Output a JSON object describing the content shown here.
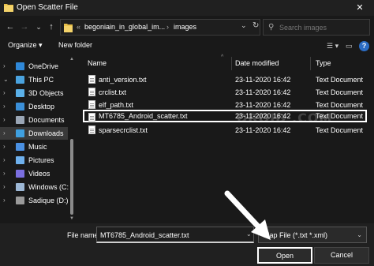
{
  "window": {
    "title": "Open Scatter File",
    "close_glyph": "✕"
  },
  "nav": {
    "back_glyph": "←",
    "forward_glyph": "→",
    "recent_glyph": "⌄",
    "up_glyph": "↑",
    "address": {
      "prefix": "«",
      "segment1": "begoniain_in_global_im...",
      "sep": "›",
      "segment2": "images",
      "dropdown_glyph": "⌄",
      "refresh_glyph": "↻"
    },
    "search_placeholder": "Search images",
    "search_glyph": "⚲"
  },
  "toolbar": {
    "organize": "Organize ▾",
    "new_folder": "New folder",
    "view_glyph": "☰ ▾",
    "pane_glyph": "▭",
    "help_glyph": "?"
  },
  "sidebar": {
    "items": [
      {
        "label": "OneDrive",
        "chevron": "›",
        "icon": "cloud-icon",
        "color": "#2f88d8"
      },
      {
        "label": "This PC",
        "chevron": "⌄",
        "icon": "computer-icon",
        "color": "#4aa3df"
      },
      {
        "label": "3D Objects",
        "chevron": "›",
        "icon": "3d-objects-icon",
        "color": "#5bb0e8"
      },
      {
        "label": "Desktop",
        "chevron": "›",
        "icon": "desktop-icon",
        "color": "#3b8fd8"
      },
      {
        "label": "Documents",
        "chevron": "›",
        "icon": "documents-icon",
        "color": "#9aa6b5"
      },
      {
        "label": "Downloads",
        "chevron": "›",
        "icon": "downloads-icon",
        "color": "#3fa0e0"
      },
      {
        "label": "Music",
        "chevron": "›",
        "icon": "music-icon",
        "color": "#4a90e2"
      },
      {
        "label": "Pictures",
        "chevron": "›",
        "icon": "pictures-icon",
        "color": "#6fb1ee"
      },
      {
        "label": "Videos",
        "chevron": "›",
        "icon": "videos-icon",
        "color": "#7b6fe0"
      },
      {
        "label": "Windows (C:",
        "chevron": "›",
        "icon": "drive-icon",
        "color": "#9db8d6"
      },
      {
        "label": "Sadique (D:)",
        "chevron": "›",
        "icon": "drive-icon",
        "color": "#9a9a9a"
      }
    ],
    "selected_index": 5
  },
  "columns": {
    "name": "Name",
    "date": "Date modified",
    "type": "Type",
    "sort_glyph": "^"
  },
  "files": [
    {
      "name": "anti_version.txt",
      "date": "23-11-2020 16:42",
      "type": "Text Document"
    },
    {
      "name": "crclist.txt",
      "date": "23-11-2020 16:42",
      "type": "Text Document"
    },
    {
      "name": "elf_path.txt",
      "date": "23-11-2020 16:42",
      "type": "Text Document"
    },
    {
      "name": "MT6785_Android_scatter.txt",
      "date": "23-11-2020 16:42",
      "type": "Text Document"
    },
    {
      "name": "sparsecrclist.txt",
      "date": "23-11-2020 16:42",
      "type": "Text Document"
    }
  ],
  "watermark": "DROID  .COM",
  "bottom": {
    "file_name_label": "File name:",
    "file_name_value": "MT6785_Android_scatter.txt",
    "file_type": "Map File (*.txt *.xml)",
    "dropdown_glyph": "⌄",
    "open": "Open",
    "cancel": "Cancel"
  }
}
